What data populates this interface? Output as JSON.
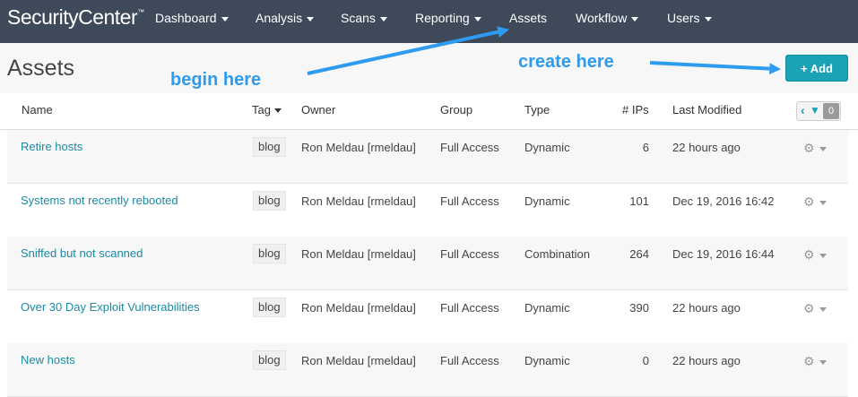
{
  "app": {
    "logo": "SecurityCenter"
  },
  "nav": [
    {
      "label": "Dashboard",
      "dropdown": true
    },
    {
      "label": "Analysis",
      "dropdown": true
    },
    {
      "label": "Scans",
      "dropdown": true
    },
    {
      "label": "Reporting",
      "dropdown": true
    },
    {
      "label": "Assets",
      "dropdown": false
    },
    {
      "label": "Workflow",
      "dropdown": true
    },
    {
      "label": "Users",
      "dropdown": true
    }
  ],
  "page": {
    "title": "Assets",
    "add_label": "+ Add"
  },
  "annotations": {
    "begin": "begin here",
    "create": "create here",
    "color": "#2d9bf0"
  },
  "table": {
    "columns": {
      "name": "Name",
      "tag": "Tag",
      "owner": "Owner",
      "group": "Group",
      "type": "Type",
      "ips": "# IPs",
      "modified": "Last Modified"
    },
    "filter_count": "0",
    "rows": [
      {
        "name": "Retire hosts",
        "tag": "blog",
        "owner": "Ron Meldau [rmeldau]",
        "group": "Full Access",
        "type": "Dynamic",
        "ips": "6",
        "modified": "22 hours ago"
      },
      {
        "name": "Systems not recently rebooted",
        "tag": "blog",
        "owner": "Ron Meldau [rmeldau]",
        "group": "Full Access",
        "type": "Dynamic",
        "ips": "101",
        "modified": "Dec 19, 2016 16:42"
      },
      {
        "name": "Sniffed but not scanned",
        "tag": "blog",
        "owner": "Ron Meldau [rmeldau]",
        "group": "Full Access",
        "type": "Combination",
        "ips": "264",
        "modified": "Dec 19, 2016 16:44"
      },
      {
        "name": "Over 30 Day Exploit Vulnerabilities",
        "tag": "blog",
        "owner": "Ron Meldau [rmeldau]",
        "group": "Full Access",
        "type": "Dynamic",
        "ips": "390",
        "modified": "22 hours ago"
      },
      {
        "name": "New hosts",
        "tag": "blog",
        "owner": "Ron Meldau [rmeldau]",
        "group": "Full Access",
        "type": "Dynamic",
        "ips": "0",
        "modified": "22 hours ago"
      }
    ]
  },
  "colors": {
    "nav_bg": "#3e4a5a",
    "accent": "#1aa3b5",
    "link": "#1a8aa3"
  }
}
